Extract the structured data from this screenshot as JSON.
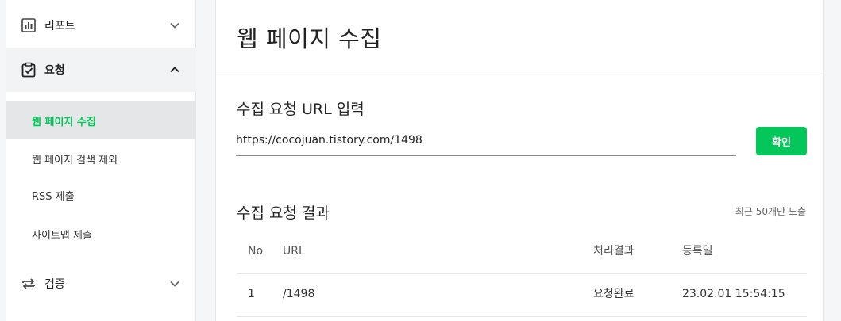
{
  "sidebar": {
    "report": {
      "label": "리포트",
      "icon": "bar-chart-icon"
    },
    "request": {
      "label": "요청",
      "icon": "clipboard-check-icon"
    },
    "sub_items": [
      {
        "label": "웹 페이지 수집",
        "active": true
      },
      {
        "label": "웹 페이지 검색 제외",
        "active": false
      },
      {
        "label": "RSS 제출",
        "active": false
      },
      {
        "label": "사이트맵 제출",
        "active": false
      }
    ],
    "verify": {
      "label": "검증",
      "icon": "swap-arrows-icon"
    }
  },
  "main": {
    "title": "웹 페이지 수집",
    "input_section": {
      "title": "수집 요청 URL 입력",
      "url_value": "https://cocojuan.tistory.com/1498",
      "confirm_label": "확인"
    },
    "result_section": {
      "title": "수집 요청 결과",
      "note": "최근 50개만 노출",
      "columns": [
        "No",
        "URL",
        "처리결과",
        "등록일"
      ],
      "rows": [
        {
          "no": "1",
          "url": "/1498",
          "status": "요청완료",
          "date": "23.02.01 15:54:15"
        }
      ]
    }
  },
  "colors": {
    "accent": "#03c75a",
    "active_bg": "#e5e6e7"
  }
}
